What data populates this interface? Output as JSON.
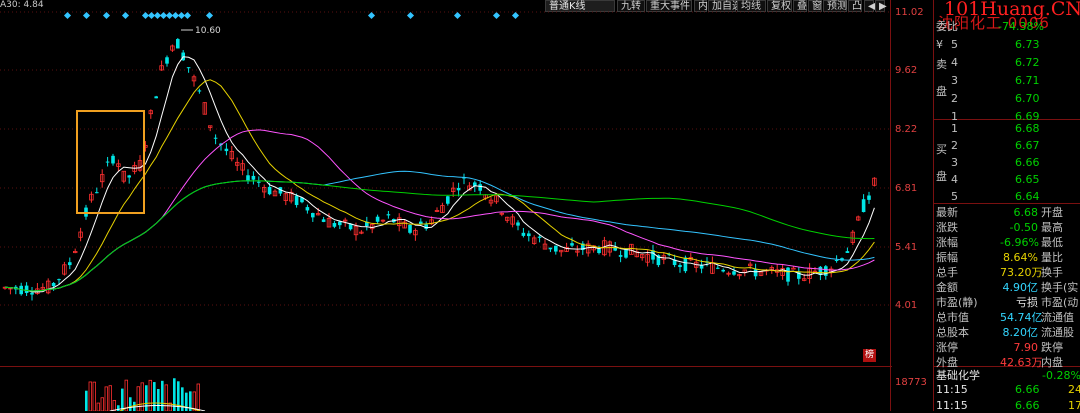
{
  "top": {
    "indicator_text": "A30: 4.84",
    "buttons": [
      "普通K线",
      "九转",
      "重大事件",
      "内",
      "加自选",
      "均线",
      "复权",
      "叠",
      "窗",
      "预测",
      "凸",
      "◀",
      "▶"
    ],
    "selected_button": "普通K线"
  },
  "watermark": "101Huang.CN",
  "stock_name": "沈阳化工 0006",
  "price_axis": [
    "11.02",
    "9.62",
    "8.22",
    "6.81",
    "5.41",
    "4.01"
  ],
  "volume_axis": "18773",
  "max_label": "10.60",
  "orderbook": {
    "wei_bi_label": "委比",
    "wei_bi_value": "-74.38%",
    "sell_side_label": "卖盘",
    "buy_side_label": "买盘",
    "sell": [
      {
        "level": "5",
        "price": "6.73"
      },
      {
        "level": "4",
        "price": "6.72"
      },
      {
        "level": "3",
        "price": "6.71"
      },
      {
        "level": "2",
        "price": "6.70"
      },
      {
        "level": "1",
        "price": "6.69"
      }
    ],
    "buy": [
      {
        "level": "1",
        "price": "6.68"
      },
      {
        "level": "2",
        "price": "6.67"
      },
      {
        "level": "3",
        "price": "6.66"
      },
      {
        "level": "4",
        "price": "6.65"
      },
      {
        "level": "5",
        "price": "6.64"
      }
    ]
  },
  "stats": [
    {
      "label": "最新",
      "value": "6.68",
      "color": "green",
      "label2": "开盘"
    },
    {
      "label": "涨跌",
      "value": "-0.50",
      "color": "green",
      "label2": "最高"
    },
    {
      "label": "涨幅",
      "value": "-6.96%",
      "color": "green",
      "label2": "最低"
    },
    {
      "label": "振幅",
      "value": "8.64%",
      "color": "yellow",
      "label2": "量比"
    },
    {
      "label": "总手",
      "value": "73.20万",
      "color": "yellow",
      "label2": "换手"
    },
    {
      "label": "金额",
      "value": "4.90亿",
      "color": "cyan",
      "label2": "换手(实"
    },
    {
      "label": "市盈(静)",
      "value": "亏损",
      "color": "white",
      "label2": "市盈(动"
    },
    {
      "label": "总市值",
      "value": "54.74亿",
      "color": "cyan",
      "label2": "流通值"
    },
    {
      "label": "总股本",
      "value": "8.20亿",
      "color": "cyan",
      "label2": "流通股"
    },
    {
      "label": "涨停",
      "value": "7.90",
      "color": "red",
      "label2": "跌停"
    },
    {
      "label": "外盘",
      "value": "42.63万",
      "color": "red",
      "label2": "内盘"
    }
  ],
  "sector": {
    "name": "基础化学",
    "change": "-0.28%"
  },
  "ticks": [
    {
      "time": "11:15",
      "price": "6.66",
      "vol": "24"
    },
    {
      "time": "11:15",
      "price": "6.66",
      "vol": "17"
    }
  ],
  "badge": "榜",
  "colors": {
    "up": "#ff3030",
    "down": "#00e5e5",
    "ma5": "#ffffff",
    "ma10": "#e6d200",
    "ma20": "#ff55ff",
    "ma60": "#00d000",
    "highlight": "#f0a020"
  }
}
